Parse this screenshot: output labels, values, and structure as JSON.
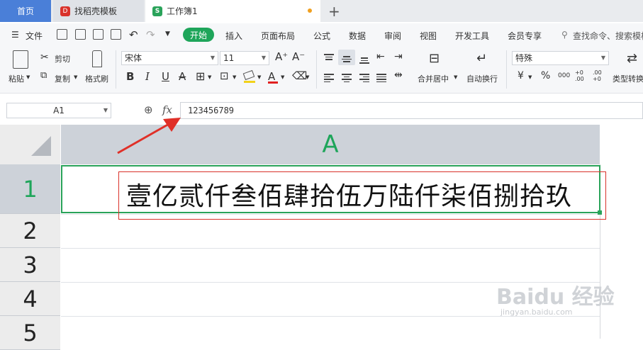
{
  "tabs": {
    "home": "首页",
    "doc": "找稻壳模板",
    "workbook": "工作簿1",
    "new_tab": "+"
  },
  "menu": {
    "file": "文件",
    "items": [
      "开始",
      "插入",
      "页面布局",
      "公式",
      "数据",
      "审阅",
      "视图",
      "开发工具",
      "会员专享"
    ],
    "search_placeholder": "查找命令、搜索模板"
  },
  "ribbon": {
    "paste": "粘贴",
    "cut": "剪切",
    "copy": "复制",
    "format_painter": "格式刷",
    "font_name": "宋体",
    "font_size": "11",
    "merge": "合并居中",
    "wrap": "自动换行",
    "number_format": "特殊",
    "convert": "类型转换",
    "increase_font": "A⁺",
    "decrease_font": "A⁻",
    "currency": "¥",
    "percent": "%",
    "thousands": "000",
    "inc_decimal": "+0 .00",
    "dec_decimal": ".00 +0",
    "bold": "B",
    "italic": "I",
    "underline": "U",
    "strike": "A",
    "font_color": "A"
  },
  "formula_bar": {
    "cell_ref": "A1",
    "fx": "fx",
    "content": "123456789"
  },
  "sheet": {
    "column": "A",
    "rows": [
      "1",
      "2",
      "3",
      "4",
      "5"
    ],
    "cell_a1_display": "壹亿贰仟叁佰肆拾伍万陆仟柒佰捌拾玖"
  },
  "colors": {
    "accent": "#1ea55a",
    "annotation": "#d9322a",
    "home_tab": "#4a7fd8"
  },
  "watermark": {
    "brand": "Baidu 经验",
    "url": "jingyan.baidu.com"
  }
}
